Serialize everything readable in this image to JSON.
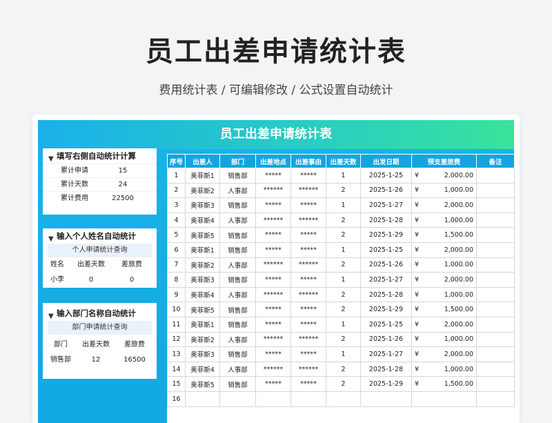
{
  "page": {
    "title": "员工出差申请统计表",
    "subtitle": "费用统计表 /  可编辑修改  / 公式设置自动统计"
  },
  "sheet": {
    "header": "员工出差申请统计表",
    "summary": {
      "title": "填写右侧自动统计计算",
      "rows": [
        {
          "label": "累计申请",
          "value": "15"
        },
        {
          "label": "累计天数",
          "value": "24"
        },
        {
          "label": "累计费用",
          "value": "22500"
        }
      ]
    },
    "person_query": {
      "title": "输入个人姓名自动统计",
      "subhead": "个人申请统计查询",
      "headers": [
        "姓名",
        "出差天数",
        "差旅费"
      ],
      "values": [
        "小李",
        "0",
        "0"
      ]
    },
    "dept_query": {
      "title": "输入部门名称自动统计",
      "subhead": "部门申请统计查询",
      "headers": [
        "部门",
        "出差天数",
        "差旅费"
      ],
      "values": [
        "销售部",
        "12",
        "16500"
      ]
    },
    "table": {
      "currency": "¥",
      "columns": [
        "序号",
        "出差人",
        "部门",
        "出差地点",
        "出差事由",
        "出差天数",
        "出发日期",
        "预支差旅费",
        "备注"
      ],
      "rows": [
        [
          "1",
          "奥菲斯1",
          "销售部",
          "*****",
          "*****",
          "1",
          "2025-1-25",
          "2,000.00",
          ""
        ],
        [
          "2",
          "奥菲斯2",
          "人事部",
          "******",
          "******",
          "2",
          "2025-1-26",
          "1,000.00",
          ""
        ],
        [
          "3",
          "奥菲斯3",
          "销售部",
          "*****",
          "*****",
          "1",
          "2025-1-27",
          "2,000.00",
          ""
        ],
        [
          "4",
          "奥菲斯4",
          "人事部",
          "******",
          "******",
          "2",
          "2025-1-28",
          "1,000.00",
          ""
        ],
        [
          "5",
          "奥菲斯5",
          "销售部",
          "*****",
          "*****",
          "2",
          "2025-1-29",
          "1,500.00",
          ""
        ],
        [
          "6",
          "奥菲斯1",
          "销售部",
          "*****",
          "*****",
          "1",
          "2025-1-25",
          "2,000.00",
          ""
        ],
        [
          "7",
          "奥菲斯2",
          "人事部",
          "******",
          "******",
          "2",
          "2025-1-26",
          "1,000.00",
          ""
        ],
        [
          "8",
          "奥菲斯3",
          "销售部",
          "*****",
          "*****",
          "1",
          "2025-1-27",
          "2,000.00",
          ""
        ],
        [
          "9",
          "奥菲斯4",
          "人事部",
          "******",
          "******",
          "2",
          "2025-1-28",
          "1,000.00",
          ""
        ],
        [
          "10",
          "奥菲斯5",
          "销售部",
          "*****",
          "*****",
          "2",
          "2025-1-29",
          "1,500.00",
          ""
        ],
        [
          "11",
          "奥菲斯1",
          "销售部",
          "*****",
          "*****",
          "1",
          "2025-1-25",
          "2,000.00",
          ""
        ],
        [
          "12",
          "奥菲斯2",
          "人事部",
          "******",
          "******",
          "2",
          "2025-1-26",
          "1,000.00",
          ""
        ],
        [
          "13",
          "奥菲斯3",
          "销售部",
          "*****",
          "*****",
          "1",
          "2025-1-27",
          "2,000.00",
          ""
        ],
        [
          "14",
          "奥菲斯4",
          "人事部",
          "******",
          "******",
          "2",
          "2025-1-28",
          "1,000.00",
          ""
        ],
        [
          "15",
          "奥菲斯5",
          "销售部",
          "*****",
          "*****",
          "2",
          "2025-1-29",
          "1,500.00",
          ""
        ],
        [
          "16",
          "",
          "",
          "",
          "",
          "",
          "",
          "",
          ""
        ]
      ]
    }
  },
  "icons": {
    "panel_marker": "triangle-down-icon"
  },
  "colors": {
    "accent_blue": "#14a5e0",
    "gradient_end": "#3be39a",
    "query_head_bg": "#e9f1fb"
  }
}
